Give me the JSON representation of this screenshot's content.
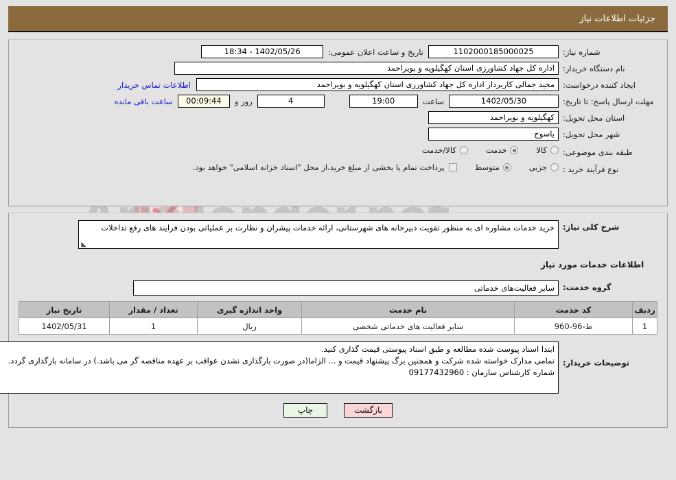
{
  "header": {
    "title": "جزئیات اطلاعات نیاز"
  },
  "watermark": {
    "text": "AriaTender.net"
  },
  "info": {
    "need_number_label": "شماره نیاز:",
    "need_number_value": "1102000185000025",
    "public_announce_label": "تاریخ و ساعت اعلان عمومی:",
    "public_announce_value": "1402/05/26 - 18:34",
    "buyer_org_label": "نام دستگاه خریدار:",
    "buyer_org_value": "اداره کل جهاد کشاورزی استان کهگیلویه و بویراحمد",
    "creator_label": "ایجاد کننده درخواست:",
    "creator_value": "مجید جمالی کاربرداز اداره کل جهاد کشاورزی استان کهگیلویه و بویراحمد",
    "contact_link": "اطلاعات تماس خریدار",
    "deadline_label": "مهلت ارسال پاسخ: تا تاریخ:",
    "deadline_date": "1402/05/30",
    "hour_label": "ساعت",
    "deadline_time": "19:00",
    "days_value": "4",
    "days_label": "روز و",
    "countdown_value": "00:09:44",
    "remaining_label": "ساعت باقی مانده",
    "province_label": "استان محل تحویل:",
    "province_value": "کهگیلویه و بویراحمد",
    "city_label": "شهر محل تحویل:",
    "city_value": "یاسوج",
    "category_label": "طبقه بندی موضوعی:",
    "category_options": [
      {
        "label": "کالا",
        "selected": false
      },
      {
        "label": "خدمت",
        "selected": true
      },
      {
        "label": "کالا/خدمت",
        "selected": false
      }
    ],
    "process_label": "نوع فرآیند خرید :",
    "process_options": [
      {
        "label": "جزیی",
        "selected": false
      },
      {
        "label": "متوسط",
        "selected": true
      }
    ],
    "treasury_checkbox_checked": false,
    "treasury_note": "پرداخت تمام یا بخشی از مبلغ خرید،از محل \"اسناد خزانه اسلامی\" خواهد بود."
  },
  "detail": {
    "summary_label": "شرح کلی نیاز:",
    "summary_value": "خرید خدمات مشاوره ای به منظور تقویت دبیرخانه های شهرستانی، ارائه خدمات پیشران و نظارت بر عملیاتی بودن فرایند های رفع تداخلات",
    "services_heading": "اطلاعات خدمات مورد نیاز",
    "service_group_label": "گروه خدمت:",
    "service_group_value": "سایر فعالیت‌های خدماتی",
    "notes_label": "توضیحات خریدار:",
    "notes_value": "ابتدا اسناد پیوست شده مطالعه و طبق اسناد پیوستی قیمت گذاری کنید.\nتمامی مدارک خواسته شده شرکت و همچنین برگ پیشنهاد قیمت و ... الزاما(در صورت بارگذاری نشدن عواقب بر عهده مناقصه گر می باشد.) در سامانه بارگذاری گردد.\nشماره کارشناس سازمان : 09177432960"
  },
  "table": {
    "columns": [
      "ردیف",
      "کد خدمت",
      "نام خدمت",
      "واحد اندازه گیری",
      "تعداد / مقدار",
      "تاریخ نیاز"
    ],
    "rows": [
      {
        "radif": "1",
        "code": "ط-96-960",
        "name": "سایر فعالیت های خدماتی شخصی",
        "unit": "ریال",
        "qty": "1",
        "date": "1402/05/31"
      }
    ]
  },
  "buttons": {
    "print": "چاپ",
    "back": "بازگشت"
  },
  "colors": {
    "header_bar": "#8b6b3d",
    "page_bg": "#e3e3e3",
    "link": "#1414d2",
    "table_header": "#c2c2c2",
    "print_button": "#e9f6e6",
    "back_button": "#fad6d6",
    "countdown_field": "#fcfbe8"
  }
}
